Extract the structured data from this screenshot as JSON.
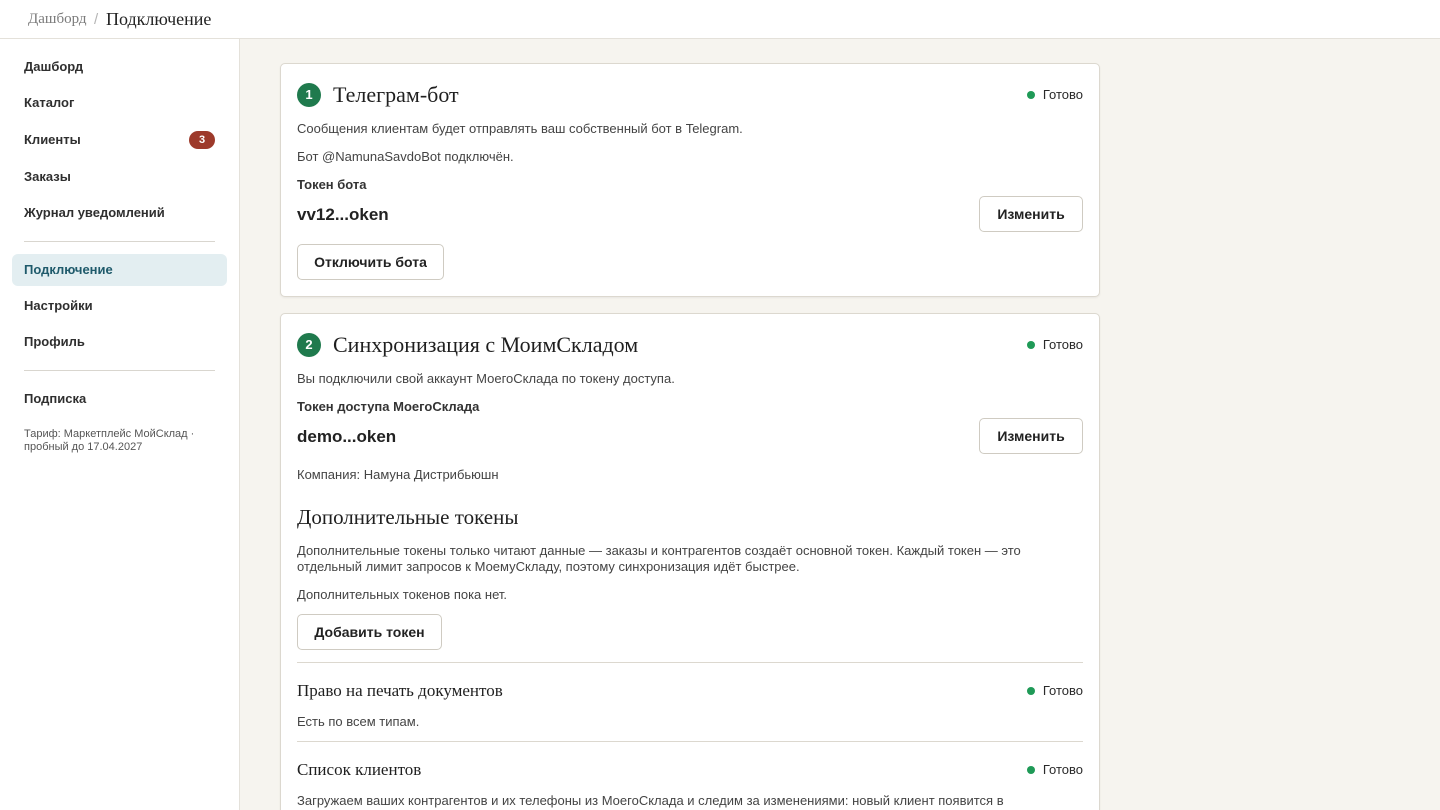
{
  "breadcrumb": {
    "parent": "Дашборд",
    "separator": "/",
    "current": "Подключение"
  },
  "sidebar": {
    "items": [
      {
        "label": "Дашборд"
      },
      {
        "label": "Каталог"
      },
      {
        "label": "Клиенты",
        "badge": "3"
      },
      {
        "label": "Заказы"
      },
      {
        "label": "Журнал уведомлений"
      },
      {
        "label": "Подключение",
        "active": true
      },
      {
        "label": "Настройки"
      },
      {
        "label": "Профиль"
      },
      {
        "label": "Подписка"
      }
    ],
    "plan_note": "Тариф: Маркетплейс МойСклад · пробный до 17.04.2027"
  },
  "telegram": {
    "step": "1",
    "title": "Телеграм-бот",
    "status": "Готово",
    "description": "Сообщения клиентам будет отправлять ваш собственный бот в Telegram.",
    "connected": "Бот @NamunaSavdoBot подключён.",
    "token_label": "Токен бота",
    "token_value": "vv12...oken",
    "change_label": "Изменить",
    "disconnect_label": "Отключить бота"
  },
  "sync": {
    "step": "2",
    "title": "Синхронизация с МоимСкладом",
    "status": "Готово",
    "description": "Вы подключили свой аккаунт МоегоСклада по токену доступа.",
    "token_label": "Токен доступа МоегоСклада",
    "token_value": "demo...oken",
    "change_label": "Изменить",
    "company": "Компания: Намуна Дистрибьюшн",
    "extra": {
      "title": "Дополнительные токены",
      "description": "Дополнительные токены только читают данные — заказы и контрагентов создаёт основной токен. Каждый токен — это отдельный лимит запросов к МоемуСкладу, поэтому синхронизация идёт быстрее.",
      "empty": "Дополнительных токенов пока нет.",
      "add_label": "Добавить токен"
    },
    "print_rights": {
      "title": "Право на печать документов",
      "status": "Готово",
      "description": "Есть по всем типам."
    },
    "clients": {
      "title": "Список клиентов",
      "status": "Готово",
      "description": "Загружаем ваших контрагентов и их телефоны из МоегоСклада и следим за изменениями: новый клиент появится в"
    }
  }
}
